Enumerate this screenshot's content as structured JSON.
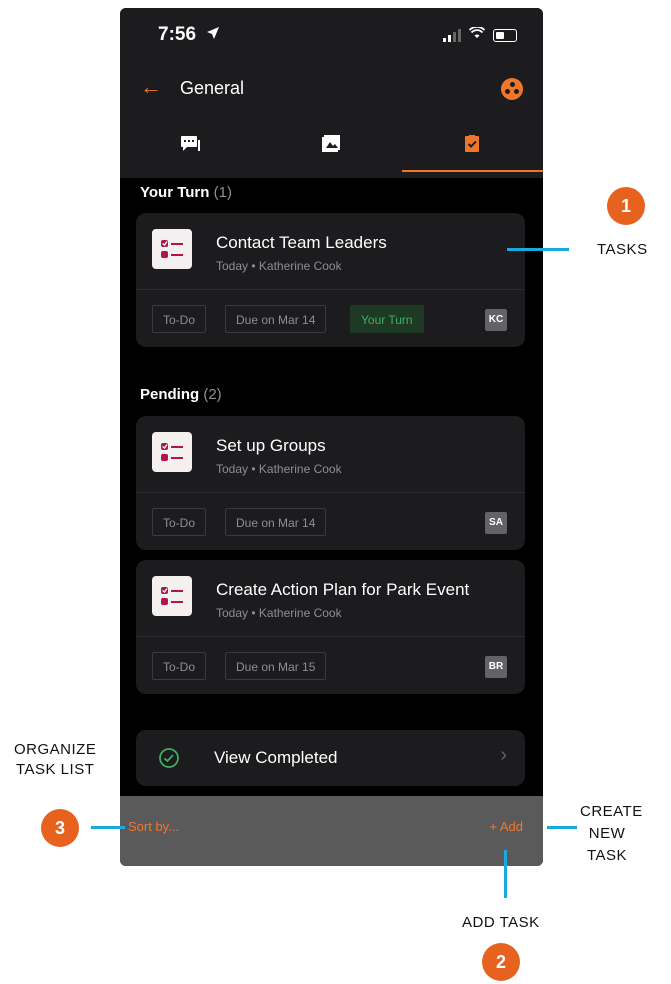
{
  "status": {
    "time": "7:56"
  },
  "nav": {
    "title": "General"
  },
  "tabs": [
    {
      "icon": "chat-icon",
      "active": false
    },
    {
      "icon": "gallery-icon",
      "active": false
    },
    {
      "icon": "task-clipboard-icon",
      "active": true
    }
  ],
  "sections": {
    "your_turn": {
      "label": "Your Turn",
      "count": "(1)"
    },
    "pending": {
      "label": "Pending",
      "count": "(2)"
    }
  },
  "tasks": [
    {
      "title": "Contact Team Leaders",
      "subtitle": "Today • Katherine Cook",
      "status": "To-Do",
      "due": "Due on Mar 14",
      "turn": "Your Turn",
      "assignee": "KC"
    },
    {
      "title": "Set up Groups",
      "subtitle": "Today • Katherine Cook",
      "status": "To-Do",
      "due": "Due on Mar 14",
      "assignee": "SA"
    },
    {
      "title": "Create Action Plan for Park Event",
      "subtitle": "Today • Katherine Cook",
      "status": "To-Do",
      "due": "Due on Mar 15",
      "assignee": "BR"
    }
  ],
  "completed": {
    "label": "View Completed"
  },
  "bottom": {
    "sort": "Sort by...",
    "add": "+ Add"
  },
  "annotations": {
    "tasks": {
      "label": "TASKS",
      "number": "1"
    },
    "add_task": {
      "label": "ADD TASK",
      "number": "2"
    },
    "organize": {
      "label_line1": "ORGANIZE",
      "label_line2": "TASK LIST",
      "number": "3"
    },
    "create": {
      "line1": "CREATE",
      "line2": "NEW",
      "line3": "TASK"
    }
  },
  "colors": {
    "accent": "#f0762b",
    "annotation_line": "#1ba8e0",
    "badge": "#e8621f",
    "turn_green": "#3fae61"
  }
}
